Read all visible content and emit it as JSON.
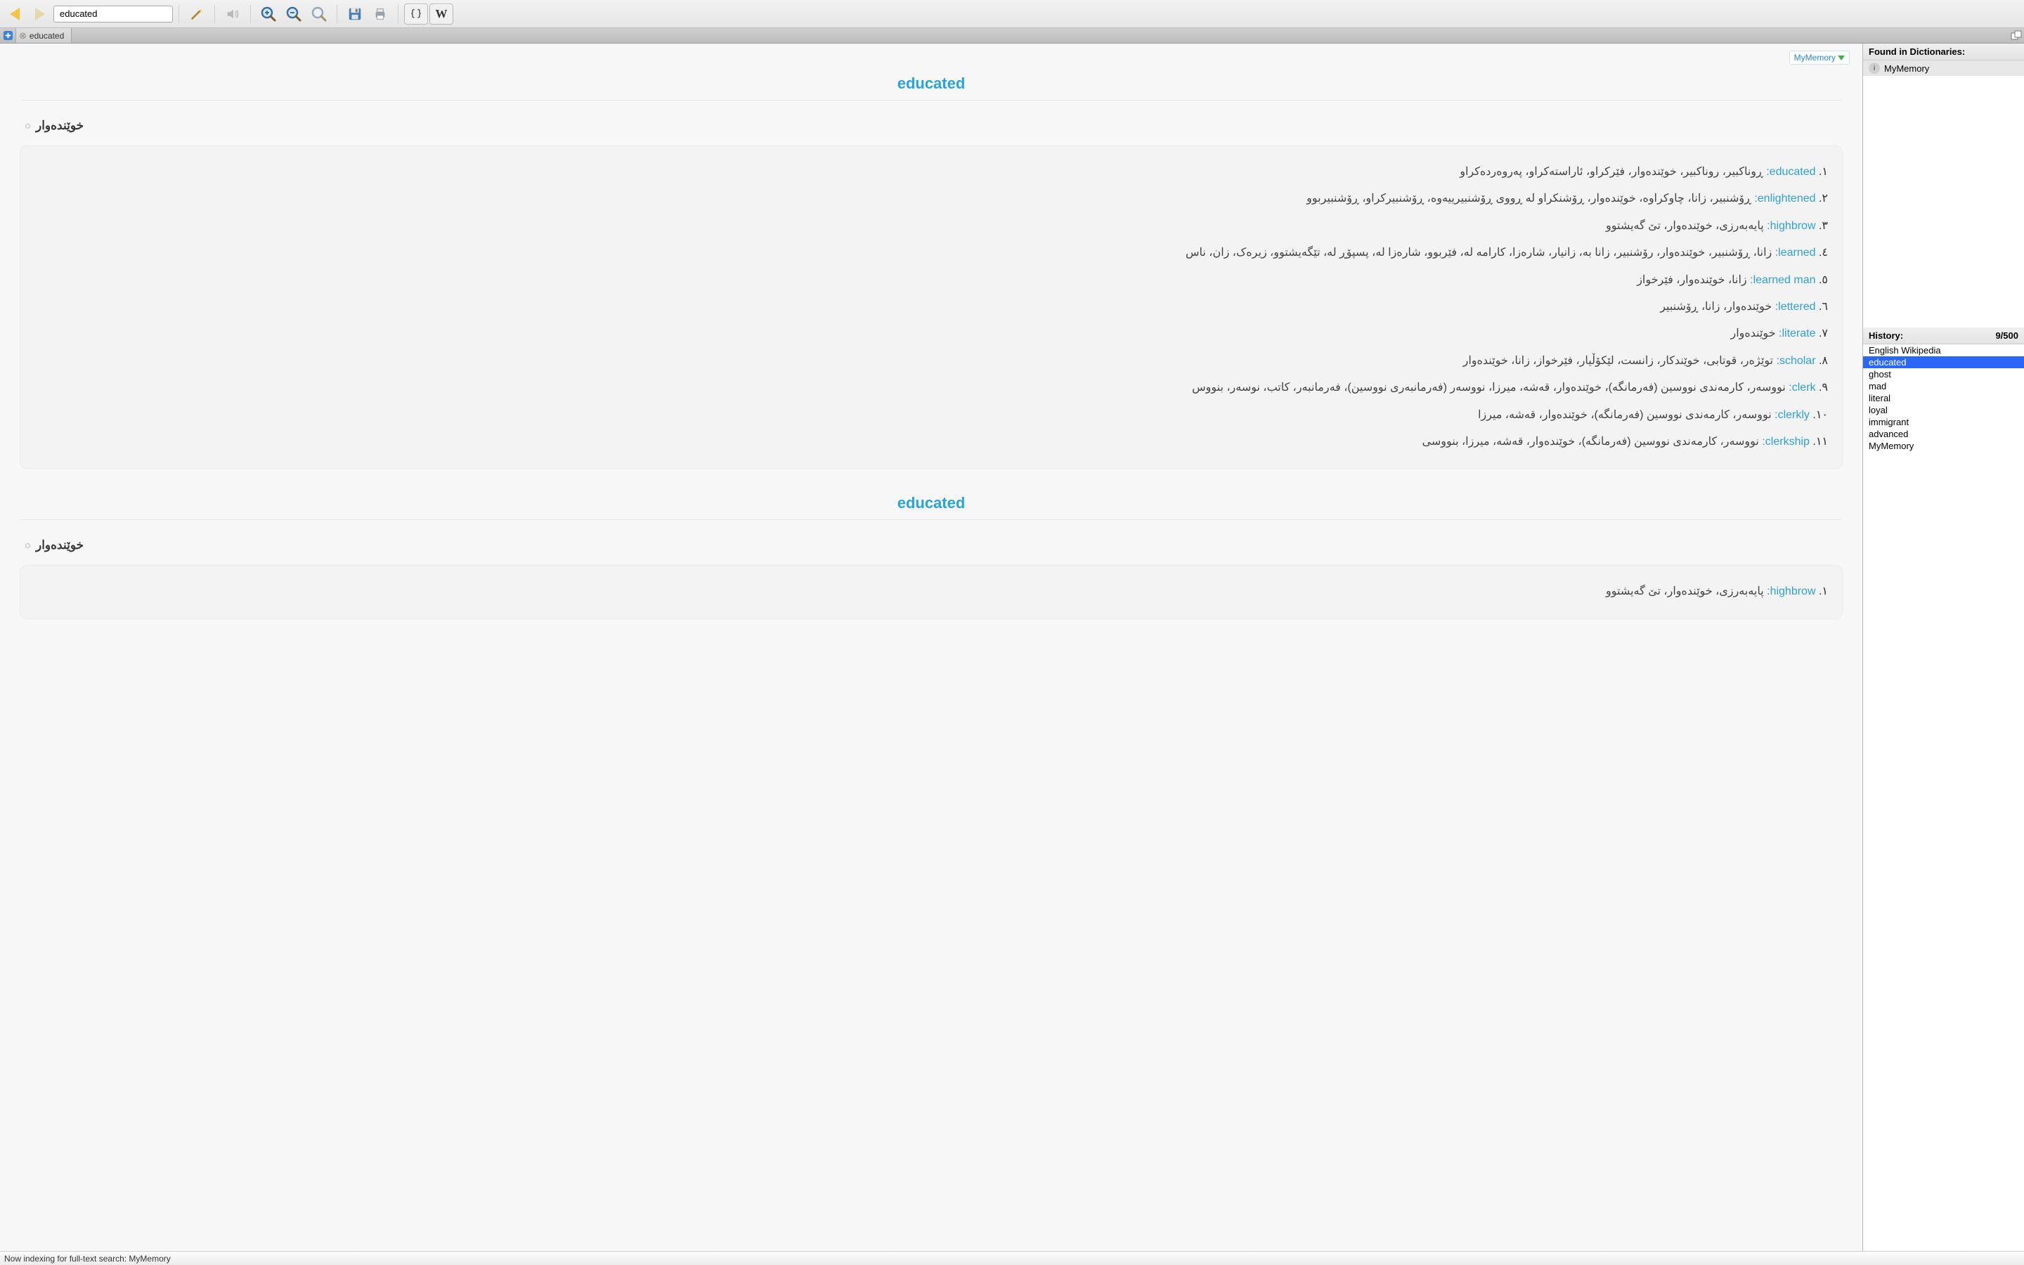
{
  "toolbar": {
    "search_value": "educated"
  },
  "tabs": {
    "active_label": "educated"
  },
  "source_badge": "MyMemory",
  "entries": [
    {
      "title": "educated",
      "headword": "خوێندەوار",
      "defs": [
        {
          "n": "١",
          "term": "educated",
          "text": "ڕوناکبیر، روناکبیر، خوێندەوار، فێرکراو، ئاراستەکراو، پەروەردەکراو"
        },
        {
          "n": "٢",
          "term": "enlightened",
          "text": "ڕۆشنبیر، زانا، چاوکراوە، خوێندەوار، ڕۆشنکراو لە ڕووی ڕۆشنبیرییەوە، ڕۆشنبیرکراو، ڕۆشنبیربوو"
        },
        {
          "n": "٣",
          "term": "highbrow",
          "text": "پایەبەرزی، خوێندەوار، تێ گەیشتوو"
        },
        {
          "n": "٤",
          "term": "learned",
          "text": "زانا، ڕۆشنبیر، خوێندەوار، رۆشنبیر، زانا بە، زانیار، شارەزا، کارامە لە، فێربوو، شارەزا لە، پسپۆڕ لە، تێگەیشتوو، زیرەک، زان، ناس"
        },
        {
          "n": "٥",
          "term": "learned man",
          "text": "زانا، خوێندەوار، فێرخواز"
        },
        {
          "n": "٦",
          "term": "lettered",
          "text": "خوێندەوار، زانا، ڕۆشنبیر"
        },
        {
          "n": "٧",
          "term": "literate",
          "text": "خوێندەوار"
        },
        {
          "n": "٨",
          "term": "scholar",
          "text": "توێژەر، قوتابی، خوێندکار، زانست، لێکۆڵیار، فێرخواز، زانا، خوێندەوار"
        },
        {
          "n": "٩",
          "term": "clerk",
          "text": "نووسەر، کارمەندی نووسین (فەرمانگە)، خوێندەوار، قەشە، میرزا، نووسەر (فەرمانبەری نووسین)، فەرمانبەر، کاتب، نوسەر، بنووس"
        },
        {
          "n": "١٠",
          "term": "clerkly",
          "text": "نووسەر، کارمەندی نووسین (فەرمانگە)، خوێندەوار، قەشە، میرزا"
        },
        {
          "n": "١١",
          "term": "clerkship",
          "text": "نووسەر، کارمەندی نووسین (فەرمانگە)، خوێندەوار، قەشە، میرزا، بنووسی"
        }
      ]
    },
    {
      "title": "educated",
      "headword": "خوێندەوار",
      "defs": [
        {
          "n": "١",
          "term": "highbrow",
          "text": "پایەبەرزی، خوێندەوار، تێ گەیشتوو"
        }
      ]
    }
  ],
  "side": {
    "found_header": "Found in Dictionaries:",
    "dicts": [
      "MyMemory"
    ],
    "history_header": "History:",
    "history_count": "9/500",
    "history": [
      "English Wikipedia",
      "educated",
      "ghost",
      "mad",
      "literal",
      "loyal",
      "immigrant",
      "advanced",
      "MyMemory"
    ],
    "history_selected_index": 1
  },
  "status": "Now indexing for full-text search: MyMemory"
}
